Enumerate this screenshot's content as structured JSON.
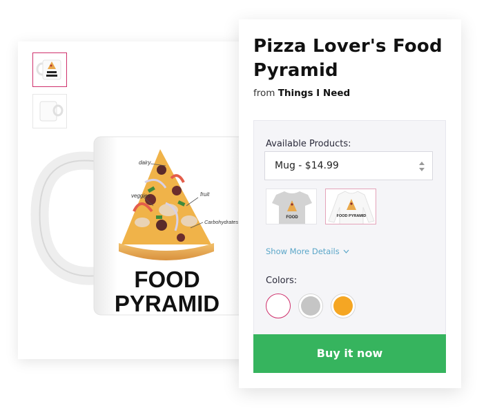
{
  "product": {
    "title": "Pizza Lover's Food Pyramid",
    "from_prefix": "from",
    "store_name": "Things I Need"
  },
  "gallery": {
    "thumbnails": [
      {
        "name": "mug-front",
        "active": true
      },
      {
        "name": "mug-back",
        "active": false
      }
    ],
    "mug_print": {
      "line1": "FOOD",
      "line2": "PYRAMID",
      "annotations": [
        "dairy",
        "veggies",
        "fruit",
        "Carbohydrates"
      ]
    }
  },
  "options": {
    "products_label": "Available Products:",
    "selected_product": "Mug - $14.99",
    "product_thumbnails": [
      {
        "name": "t-shirt",
        "print_text": "FOOD",
        "selected": false
      },
      {
        "name": "long-sleeve",
        "print_text": "FOOD PYRAMID",
        "selected": true
      }
    ],
    "show_more_label": "Show More Details",
    "colors_label": "Colors:",
    "colors": [
      {
        "name": "white",
        "hex": "#ffffff",
        "active": true
      },
      {
        "name": "gray",
        "hex": "#c5c5c5",
        "active": false
      },
      {
        "name": "orange",
        "hex": "#f5a623",
        "active": false
      }
    ]
  },
  "buy_button_label": "Buy it now",
  "theme": {
    "accent_pink": "#cf2f6b",
    "buy_green": "#36b45e",
    "link_blue": "#5aa6c8"
  }
}
